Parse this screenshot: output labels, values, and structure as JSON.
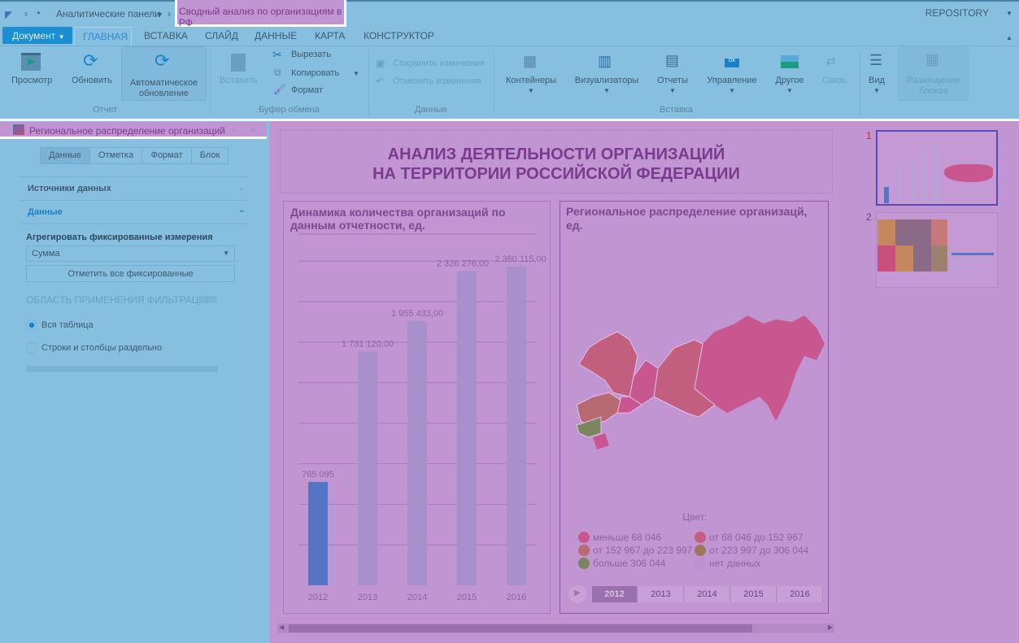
{
  "topbar": {
    "breadcrumb_root": "Аналитические панели",
    "doc_title": "Сводный анализ по организациям в РФ",
    "repository": "REPOSITORY"
  },
  "menu": {
    "document": "Документ",
    "tabs": [
      "ГЛАВНАЯ",
      "ВСТАВКА",
      "СЛАЙД",
      "ДАННЫЕ",
      "КАРТА",
      "КОНСТРУКТОР"
    ]
  },
  "ribbon": {
    "preview": "Просмотр",
    "refresh": "Обновить",
    "auto_refresh": "Автоматическое обновление",
    "group_report": "Отчет",
    "paste": "Вставить",
    "cut": "Вырезать",
    "copy": "Копировать",
    "format": "Формат",
    "group_clipboard": "Буфер обмена",
    "save": "Сохранить изменения",
    "undo": "Отменить изменения",
    "group_data": "Данные",
    "containers": "Контейнеры",
    "visualizers": "Визуализаторы",
    "reports": "Отчеты",
    "controls": "Управление",
    "other": "Другое",
    "link": "Связь",
    "group_insert": "Вставка",
    "view": "Вид",
    "layout": "Размещение блоков"
  },
  "panel": {
    "title": "Региональное распределение организаций",
    "tabs": [
      "Данные",
      "Отметка",
      "Формат",
      "Блок"
    ],
    "sources": "Источники данных",
    "data": "Данные",
    "aggregate_label": "Агрегировать фиксированные измерения",
    "aggregate_value": "Сумма",
    "mark_all": "Отметить все фиксированные",
    "filter_scope": "ОБЛАСТЬ ПРИМЕНЕНИЯ ФИЛЬТРАЦИИ",
    "radio_all": "Вся таблица",
    "radio_sep": "Строки и столбцы раздельно"
  },
  "slide": {
    "title1": "АНАЛИЗ ДЕЯТЕЛЬНОСТИ ОРГАНИЗАЦИЙ",
    "title2": "НА ТЕРРИТОРИИ РОССИЙСКОЙ ФЕДЕРАЦИИ",
    "map_title": "Региональное распределение организацй, ед.",
    "legend_title": "Цвет:",
    "legend": [
      {
        "label": "меньше 68 046",
        "color": "#c9578f"
      },
      {
        "label": "от 68 046 до 152 967",
        "color": "#c25e7e"
      },
      {
        "label": "от 152 967 до 223 997",
        "color": "#b86a73"
      },
      {
        "label": "от 223 997 до 306 044",
        "color": "#9e7759"
      },
      {
        "label": "больше 306 044",
        "color": "#7c8560"
      },
      {
        "label": "нет данных",
        "color": "#bd91cd"
      }
    ],
    "years": [
      "2012",
      "2013",
      "2014",
      "2015",
      "2016"
    ],
    "selected_year": "2012"
  },
  "chart_data": {
    "type": "bar",
    "title": "Динамика количества организаций по данным отчетности, ед.",
    "categories": [
      "2012",
      "2013",
      "2014",
      "2015",
      "2016"
    ],
    "values": [
      765095,
      1731120,
      1955433,
      2326276,
      2360115
    ],
    "labels": [
      "765 095",
      "1 731 120,00",
      "1 955 433,00",
      "2 326 276,00",
      "2 360 115,00"
    ],
    "ylim": [
      0,
      2600000
    ],
    "grid": true,
    "highlight": "2012",
    "colors": {
      "highlight": "#5474c4",
      "other": "#a98fcb"
    }
  },
  "thumbs": [
    "1",
    "2"
  ]
}
